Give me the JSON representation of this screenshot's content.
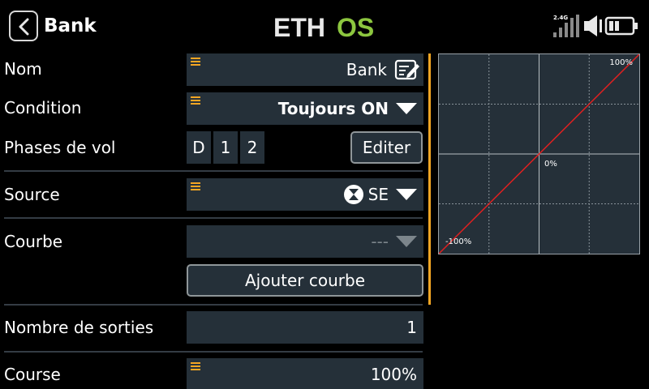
{
  "header": {
    "title": "Bank",
    "logo_text": "ETHOS",
    "signal_label": "2.4G"
  },
  "form": {
    "name": {
      "label": "Nom",
      "value": "Bank"
    },
    "condition": {
      "label": "Condition",
      "value": "Toujours ON"
    },
    "flight_modes": {
      "label": "Phases de vol",
      "chips": [
        "D",
        "1",
        "2"
      ],
      "edit_label": "Editer"
    },
    "source": {
      "label": "Source",
      "value": "SE"
    },
    "curve": {
      "label": "Courbe",
      "value": "---",
      "add_label": "Ajouter courbe"
    },
    "outputs": {
      "label": "Nombre de sorties",
      "value": "1"
    },
    "course": {
      "label": "Course",
      "value": "100%"
    }
  },
  "graph": {
    "label_top_right": "100%",
    "label_center": "0%",
    "label_bottom_left": "-100%"
  },
  "colors": {
    "accent": "#f5a623",
    "field_bg": "#253039",
    "logo_green": "#8cc63f",
    "curve_line": "#e02020"
  }
}
